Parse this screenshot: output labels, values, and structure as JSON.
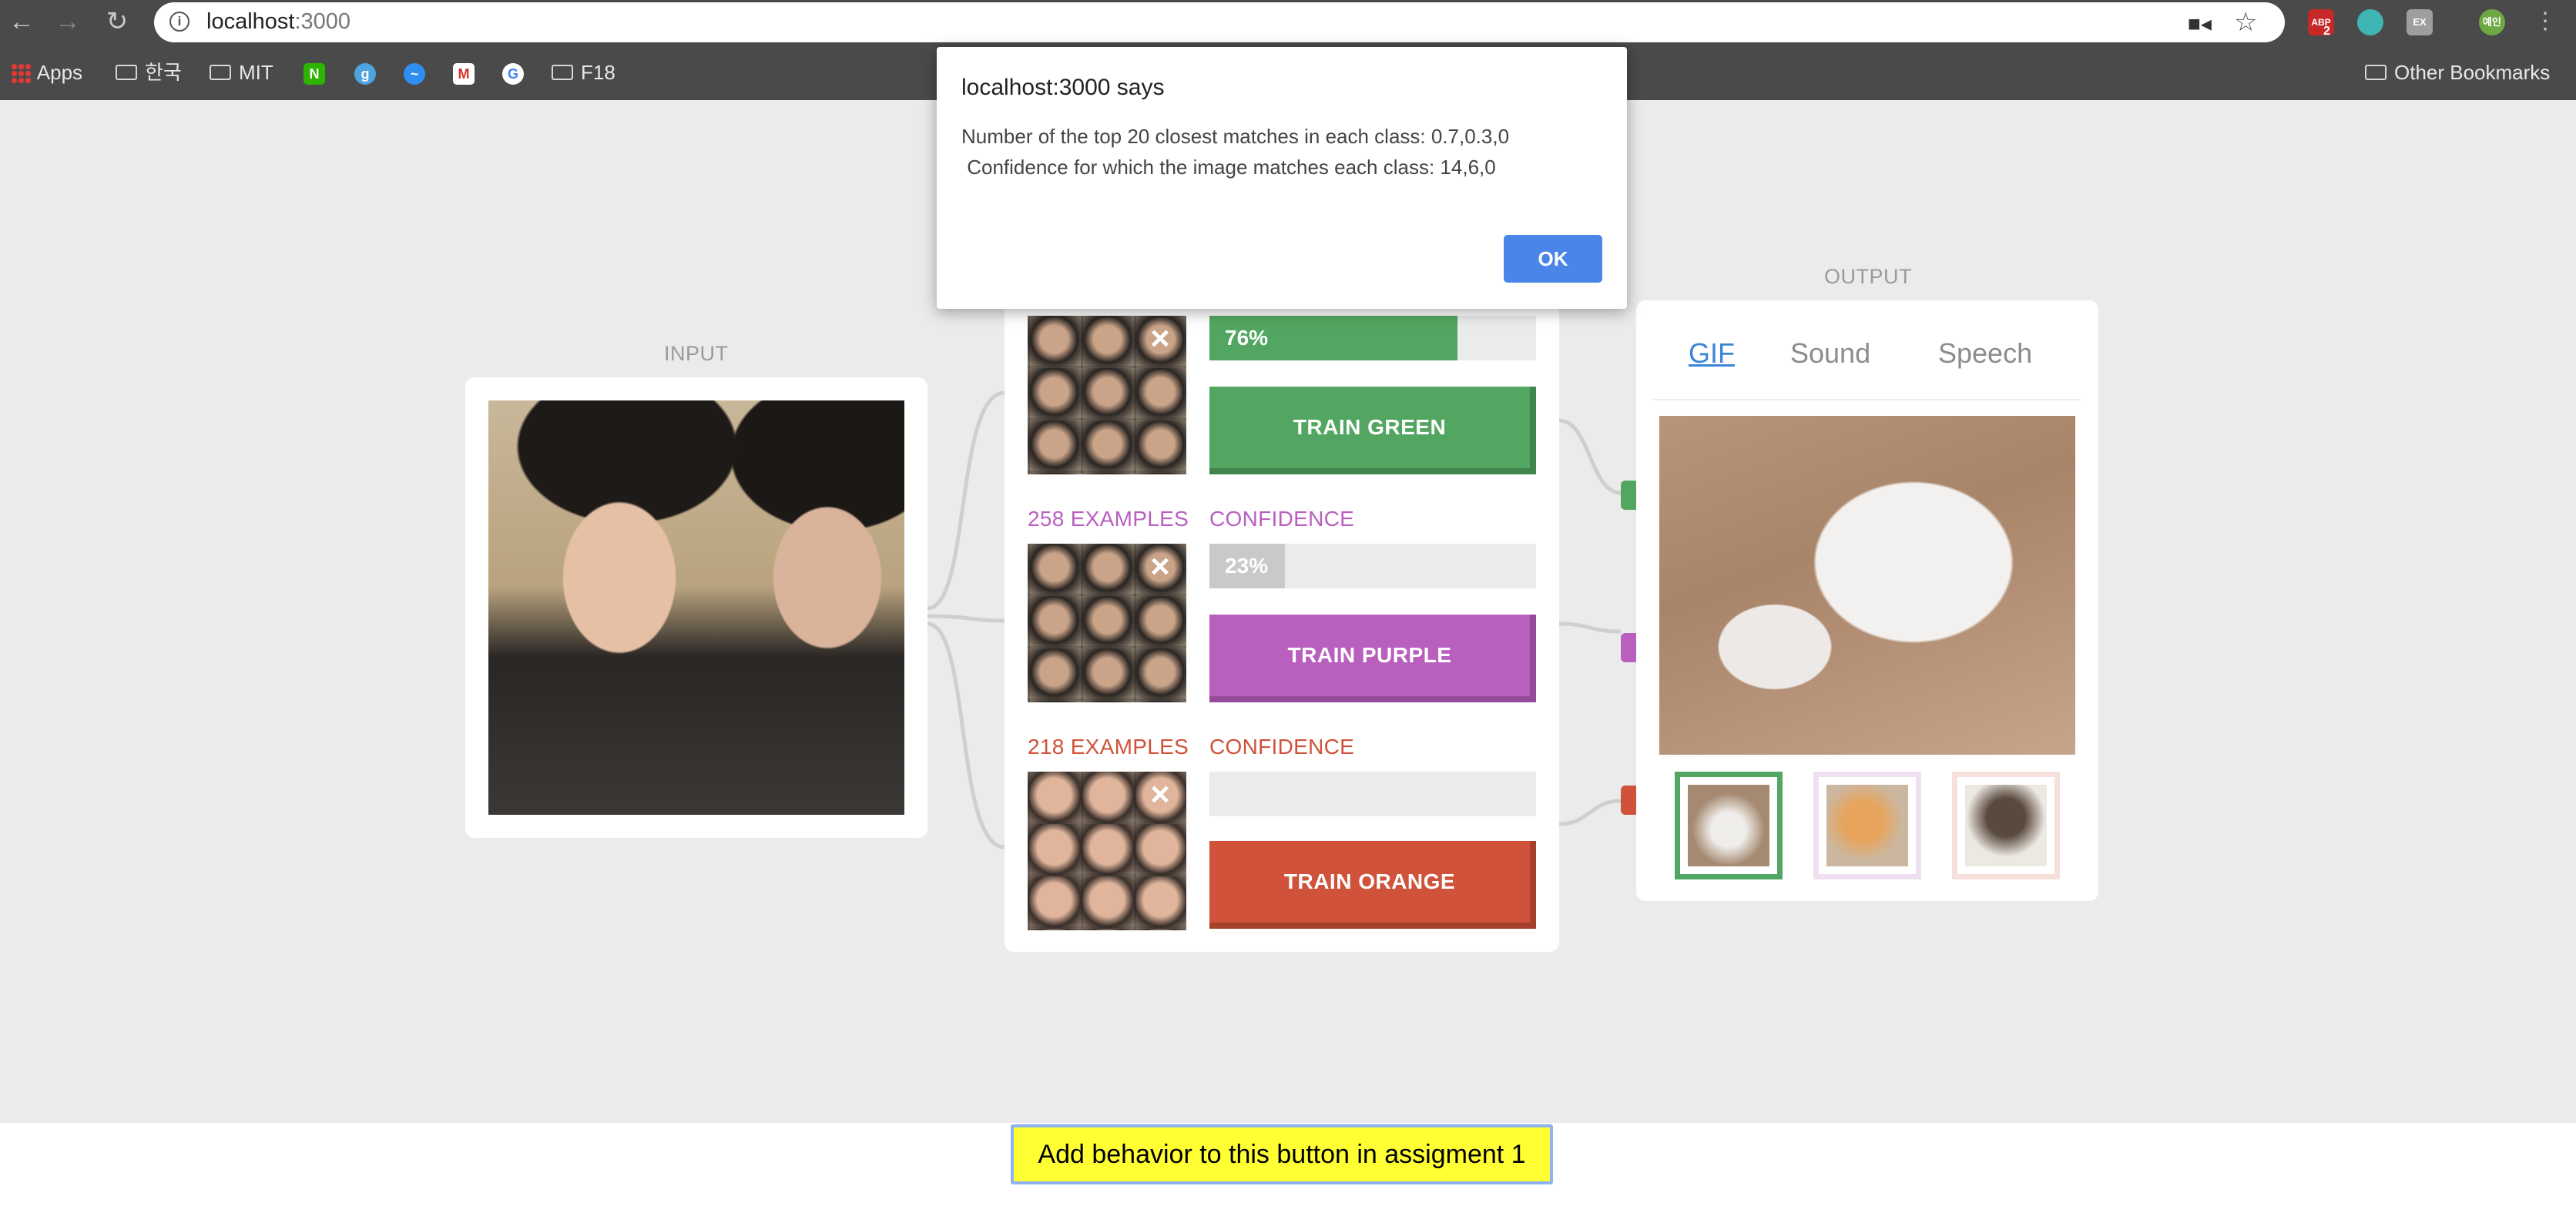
{
  "browser": {
    "url_host": "localhost",
    "url_port": ":3000",
    "bookmarks": [
      "Apps",
      "한국",
      "MIT",
      "F18"
    ],
    "other_bookmarks": "Other Bookmarks",
    "ext_abp": "ABP",
    "ext_abp_badge": "2",
    "ext_ex": "EX",
    "profile": "예인"
  },
  "app": {
    "input_label": "INPUT",
    "output_label": "OUTPUT",
    "classes": [
      {
        "color": "#53a661",
        "examples": "",
        "confidence_label": "",
        "confidence_text": "76%",
        "confidence": 0.76,
        "train_label": "TRAIN GREEN"
      },
      {
        "color": "#b960bf",
        "examples": "258 EXAMPLES",
        "confidence_label": "CONFIDENCE",
        "confidence_text": "23%",
        "confidence": 0.23,
        "fill": "#c9c9c9",
        "train_label": "TRAIN PURPLE"
      },
      {
        "color": "#d0523a",
        "examples": "218 EXAMPLES",
        "confidence_label": "CONFIDENCE",
        "confidence_text": "",
        "confidence": 0,
        "train_label": "TRAIN ORANGE"
      }
    ],
    "tabs": [
      "GIF",
      "Sound",
      "Speech"
    ],
    "active_tab": "GIF"
  },
  "assignment_button": "Add behavior to this button in assigment 1",
  "dialog": {
    "title": "localhost:3000 says",
    "message": "Number of the top 20 closest matches in each class: 0.7,0.3,0\n Confidence for which the image matches each class: 14,6,0",
    "ok": "OK"
  }
}
